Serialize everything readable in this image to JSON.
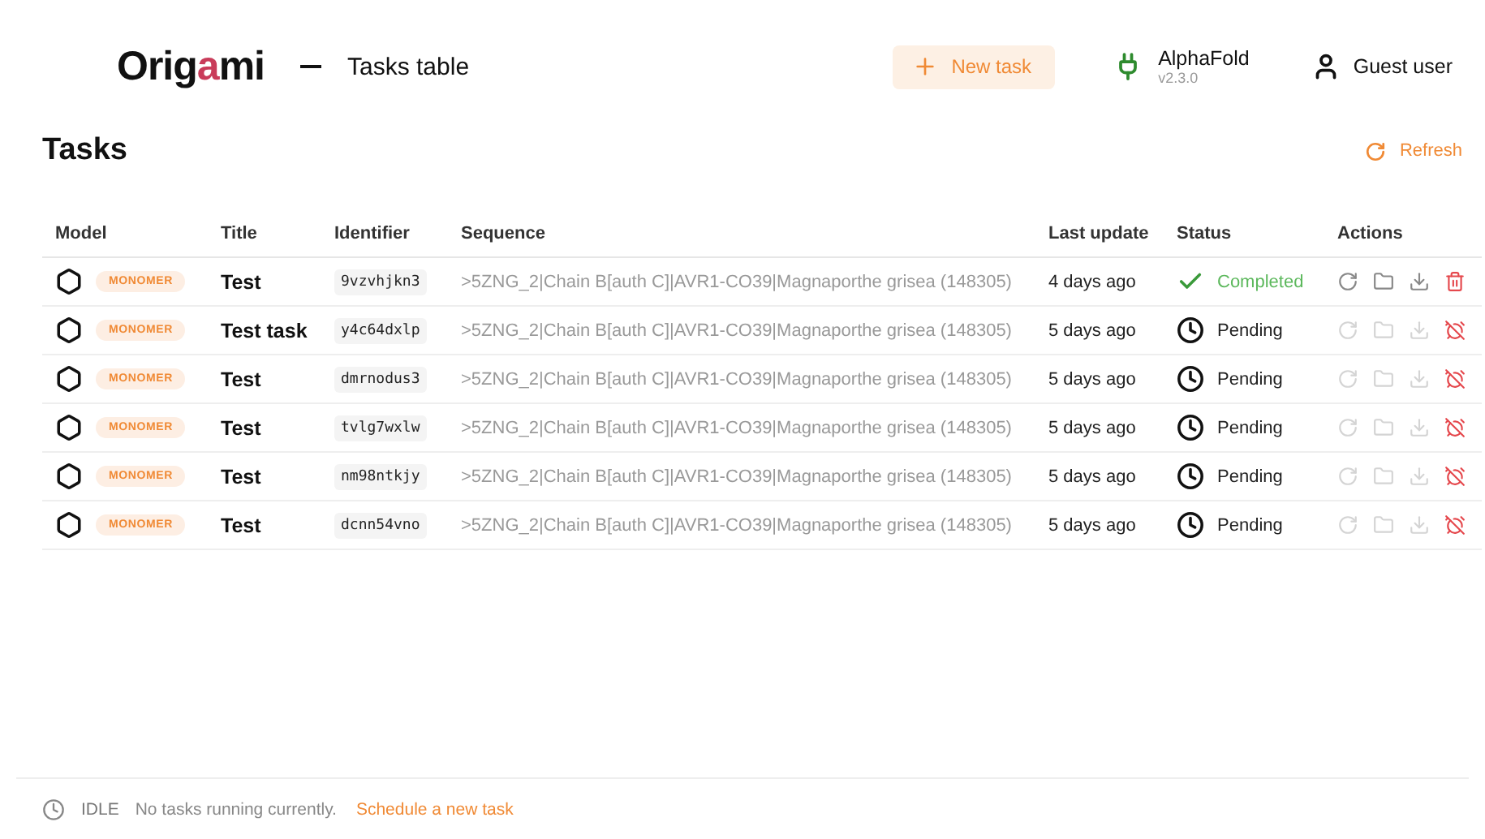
{
  "logo": {
    "before": "Orig",
    "accent": "a",
    "after": "mi"
  },
  "page_title": "Tasks table",
  "new_task_button": "New task",
  "engine": {
    "name": "AlphaFold",
    "version": "v2.3.0"
  },
  "user": "Guest user",
  "heading": "Tasks",
  "refresh_button": "Refresh",
  "table": {
    "columns": [
      "Model",
      "Title",
      "Identifier",
      "Sequence",
      "Last update",
      "Status",
      "Actions"
    ],
    "rows": [
      {
        "model": "MONOMER",
        "title": "Test",
        "identifier": "9vzvhjkn3",
        "sequence": ">5ZNG_2|Chain B[auth C]|AVR1-CO39|Magnaporthe grisea (148305)",
        "updated": "4 days ago",
        "status": {
          "kind": "completed",
          "label": "Completed"
        },
        "actions": [
          {
            "kind": "rerun",
            "disabled": false
          },
          {
            "kind": "folder",
            "disabled": false
          },
          {
            "kind": "download",
            "disabled": false
          },
          {
            "kind": "delete",
            "disabled": false
          }
        ]
      },
      {
        "model": "MONOMER",
        "title": "Test task",
        "identifier": "y4c64dxlp",
        "sequence": ">5ZNG_2|Chain B[auth C]|AVR1-CO39|Magnaporthe grisea (148305)",
        "updated": "5 days ago",
        "status": {
          "kind": "pending",
          "label": "Pending"
        },
        "actions": [
          {
            "kind": "rerun",
            "disabled": true
          },
          {
            "kind": "folder",
            "disabled": true
          },
          {
            "kind": "download",
            "disabled": true
          },
          {
            "kind": "cancel",
            "disabled": false
          }
        ]
      },
      {
        "model": "MONOMER",
        "title": "Test",
        "identifier": "dmrnodus3",
        "sequence": ">5ZNG_2|Chain B[auth C]|AVR1-CO39|Magnaporthe grisea (148305)",
        "updated": "5 days ago",
        "status": {
          "kind": "pending",
          "label": "Pending"
        },
        "actions": [
          {
            "kind": "rerun",
            "disabled": true
          },
          {
            "kind": "folder",
            "disabled": true
          },
          {
            "kind": "download",
            "disabled": true
          },
          {
            "kind": "cancel",
            "disabled": false
          }
        ]
      },
      {
        "model": "MONOMER",
        "title": "Test",
        "identifier": "tvlg7wxlw",
        "sequence": ">5ZNG_2|Chain B[auth C]|AVR1-CO39|Magnaporthe grisea (148305)",
        "updated": "5 days ago",
        "status": {
          "kind": "pending",
          "label": "Pending"
        },
        "actions": [
          {
            "kind": "rerun",
            "disabled": true
          },
          {
            "kind": "folder",
            "disabled": true
          },
          {
            "kind": "download",
            "disabled": true
          },
          {
            "kind": "cancel",
            "disabled": false
          }
        ]
      },
      {
        "model": "MONOMER",
        "title": "Test",
        "identifier": "nm98ntkjy",
        "sequence": ">5ZNG_2|Chain B[auth C]|AVR1-CO39|Magnaporthe grisea (148305)",
        "updated": "5 days ago",
        "status": {
          "kind": "pending",
          "label": "Pending"
        },
        "actions": [
          {
            "kind": "rerun",
            "disabled": true
          },
          {
            "kind": "folder",
            "disabled": true
          },
          {
            "kind": "download",
            "disabled": true
          },
          {
            "kind": "cancel",
            "disabled": false
          }
        ]
      },
      {
        "model": "MONOMER",
        "title": "Test",
        "identifier": "dcnn54vno",
        "sequence": ">5ZNG_2|Chain B[auth C]|AVR1-CO39|Magnaporthe grisea (148305)",
        "updated": "5 days ago",
        "status": {
          "kind": "pending",
          "label": "Pending"
        },
        "actions": [
          {
            "kind": "rerun",
            "disabled": true
          },
          {
            "kind": "folder",
            "disabled": true
          },
          {
            "kind": "download",
            "disabled": true
          },
          {
            "kind": "cancel",
            "disabled": false
          }
        ]
      }
    ]
  },
  "footer": {
    "state": "IDLE",
    "message": "No tasks running currently.",
    "link": "Schedule a new task"
  }
}
